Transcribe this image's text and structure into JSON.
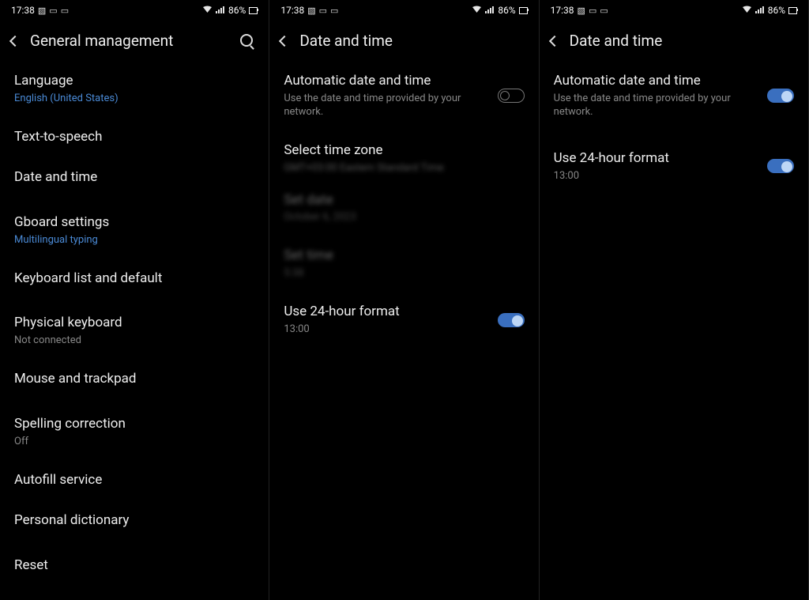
{
  "status": {
    "time": "17:38",
    "battery": "86%"
  },
  "panel1": {
    "title": "General management",
    "items": [
      {
        "title": "Language",
        "sub": "English (United States)",
        "blue": true
      },
      {
        "title": "Text-to-speech"
      },
      {
        "title": "Date and time"
      },
      {
        "title": "Gboard settings",
        "sub": "Multilingual typing",
        "blue": true
      },
      {
        "title": "Keyboard list and default"
      },
      {
        "title": "Physical keyboard",
        "sub": "Not connected"
      },
      {
        "title": "Mouse and trackpad"
      },
      {
        "title": "Spelling correction",
        "sub": "Off"
      },
      {
        "title": "Autofill service"
      },
      {
        "title": "Personal dictionary"
      },
      {
        "title": "Reset"
      }
    ]
  },
  "panel2": {
    "title": "Date and time",
    "auto": {
      "title": "Automatic date and time",
      "sub": "Use the date and time provided by your network.",
      "on": false
    },
    "tz_label": "Select time zone",
    "blurred1_title": "Set date",
    "blurred1_sub": "October 6, 2023",
    "blurred2_title": "Set time",
    "blurred2_sub": "5:38",
    "h24": {
      "title": "Use 24-hour format",
      "sub": "13:00",
      "on": true
    }
  },
  "panel3": {
    "title": "Date and time",
    "auto": {
      "title": "Automatic date and time",
      "sub": "Use the date and time provided by your network.",
      "on": true
    },
    "h24": {
      "title": "Use 24-hour format",
      "sub": "13:00",
      "on": true
    }
  }
}
